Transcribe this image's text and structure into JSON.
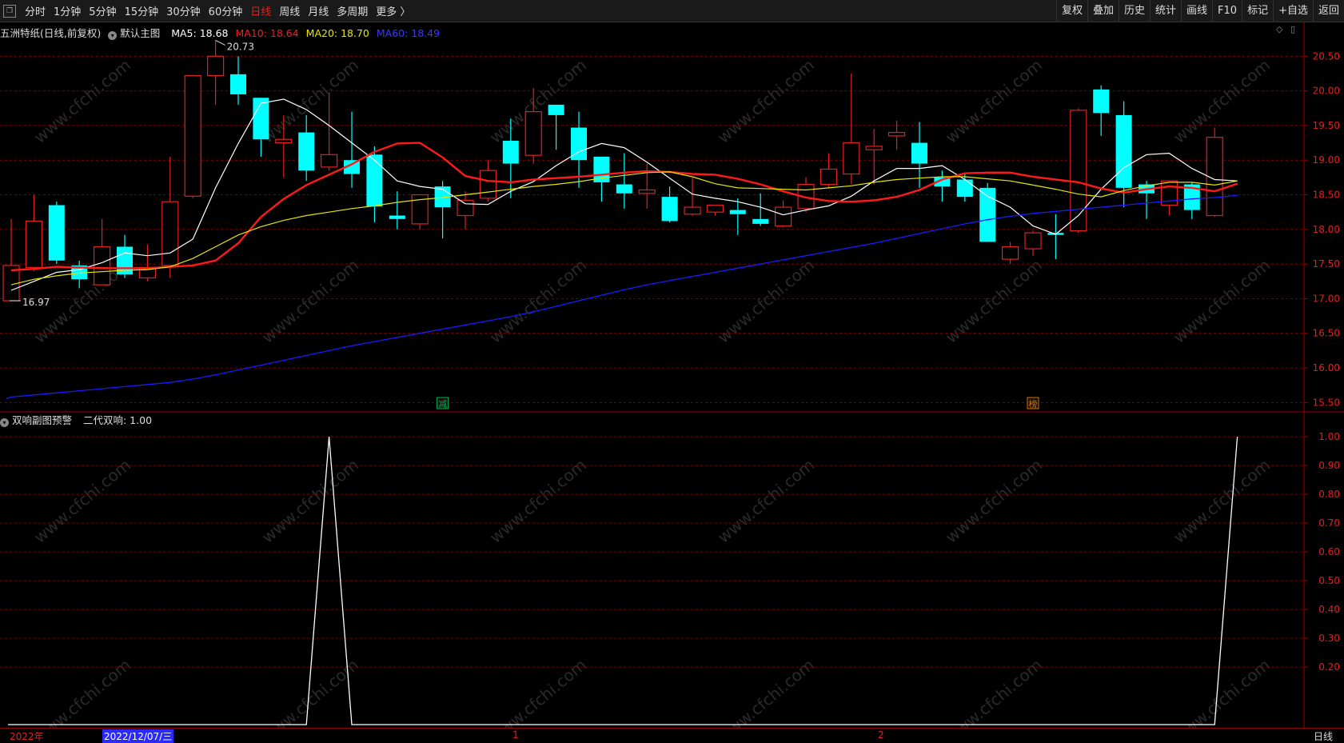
{
  "toolbar": {
    "window_icon": "window-restore-icon",
    "periods": [
      "分时",
      "1分钟",
      "5分钟",
      "15分钟",
      "30分钟",
      "60分钟",
      "日线",
      "周线",
      "月线",
      "多周期",
      "更多 〉"
    ],
    "active_period": "日线",
    "tools": [
      "复权",
      "叠加",
      "历史",
      "统计",
      "画线",
      "F10",
      "标记",
      "+自选",
      "返回"
    ]
  },
  "main_panel": {
    "title": "五洲特纸(日线,前复权)",
    "indicator_name": "默认主图",
    "ma5_label": "MA5: 18.68",
    "ma10_label": "MA10: 18.64",
    "ma20_label": "MA20: 18.70",
    "ma60_label": "MA60: 18.49",
    "high_marker": "20.73",
    "low_marker": "16.97",
    "event_tags": [
      "减",
      "榜"
    ]
  },
  "sub_panel": {
    "indicator_name": "双响副图预警",
    "value_label": "二代双响: 1.00"
  },
  "date_axis": {
    "year_label": "2022年",
    "cursor_date": "2022/12/07/三",
    "month_1": "1",
    "month_2": "2",
    "period_tag": "日线"
  },
  "watermark": "www.cfchi.com",
  "colors": {
    "up": "#e02020",
    "down": "#00ffff",
    "ma5": "#ffffff",
    "ma10": "#ff1a1a",
    "ma20": "#e6e600",
    "ma60": "#1a1aff",
    "grid": "#7a0000"
  },
  "chart_data": [
    {
      "type": "candlestick",
      "title": "五洲特纸(日线,前复权)",
      "ylim": [
        15.4,
        20.85
      ],
      "y_ticks": [
        15.5,
        16.0,
        16.5,
        17.0,
        17.5,
        18.0,
        18.5,
        19.0,
        19.5,
        20.0,
        20.5
      ],
      "candles": [
        {
          "o": 16.97,
          "h": 18.15,
          "l": 16.97,
          "c": 17.48
        },
        {
          "o": 17.45,
          "h": 18.5,
          "l": 17.4,
          "c": 18.12
        },
        {
          "o": 18.35,
          "h": 18.4,
          "l": 17.5,
          "c": 17.55
        },
        {
          "o": 17.48,
          "h": 17.55,
          "l": 17.15,
          "c": 17.28
        },
        {
          "o": 17.2,
          "h": 18.15,
          "l": 17.2,
          "c": 17.75
        },
        {
          "o": 17.75,
          "h": 17.92,
          "l": 17.3,
          "c": 17.35
        },
        {
          "o": 17.3,
          "h": 17.78,
          "l": 17.25,
          "c": 17.45
        },
        {
          "o": 17.48,
          "h": 19.05,
          "l": 17.3,
          "c": 18.4
        },
        {
          "o": 18.48,
          "h": 20.2,
          "l": 18.45,
          "c": 20.22
        },
        {
          "o": 20.22,
          "h": 20.73,
          "l": 19.8,
          "c": 20.5
        },
        {
          "o": 20.24,
          "h": 20.5,
          "l": 19.8,
          "c": 19.95
        },
        {
          "o": 19.9,
          "h": 19.9,
          "l": 19.05,
          "c": 19.3
        },
        {
          "o": 19.25,
          "h": 19.65,
          "l": 18.75,
          "c": 19.3
        },
        {
          "o": 19.4,
          "h": 19.65,
          "l": 18.7,
          "c": 18.85
        },
        {
          "o": 18.9,
          "h": 19.98,
          "l": 18.85,
          "c": 19.08
        },
        {
          "o": 19.0,
          "h": 19.7,
          "l": 18.6,
          "c": 18.8
        },
        {
          "o": 19.08,
          "h": 19.2,
          "l": 18.1,
          "c": 18.33
        },
        {
          "o": 18.2,
          "h": 18.55,
          "l": 18.0,
          "c": 18.15
        },
        {
          "o": 18.08,
          "h": 18.5,
          "l": 18.0,
          "c": 18.5
        },
        {
          "o": 18.62,
          "h": 18.7,
          "l": 17.87,
          "c": 18.32
        },
        {
          "o": 18.2,
          "h": 18.55,
          "l": 18.0,
          "c": 18.42
        },
        {
          "o": 18.45,
          "h": 19.0,
          "l": 18.4,
          "c": 18.85
        },
        {
          "o": 19.28,
          "h": 19.6,
          "l": 18.45,
          "c": 18.95
        },
        {
          "o": 19.07,
          "h": 20.04,
          "l": 18.95,
          "c": 19.7
        },
        {
          "o": 19.8,
          "h": 19.8,
          "l": 19.15,
          "c": 19.65
        },
        {
          "o": 19.47,
          "h": 19.7,
          "l": 18.6,
          "c": 19.0
        },
        {
          "o": 19.05,
          "h": 19.05,
          "l": 18.4,
          "c": 18.68
        },
        {
          "o": 18.65,
          "h": 19.1,
          "l": 18.3,
          "c": 18.52
        },
        {
          "o": 18.52,
          "h": 18.95,
          "l": 18.3,
          "c": 18.57
        },
        {
          "o": 18.47,
          "h": 18.62,
          "l": 18.1,
          "c": 18.12
        },
        {
          "o": 18.22,
          "h": 18.75,
          "l": 18.2,
          "c": 18.32
        },
        {
          "o": 18.25,
          "h": 18.35,
          "l": 18.2,
          "c": 18.35
        },
        {
          "o": 18.28,
          "h": 18.45,
          "l": 17.92,
          "c": 18.22
        },
        {
          "o": 18.15,
          "h": 18.52,
          "l": 18.05,
          "c": 18.08
        },
        {
          "o": 18.05,
          "h": 18.42,
          "l": 18.03,
          "c": 18.32
        },
        {
          "o": 18.3,
          "h": 18.75,
          "l": 18.25,
          "c": 18.65
        },
        {
          "o": 18.65,
          "h": 19.1,
          "l": 18.6,
          "c": 18.87
        },
        {
          "o": 18.8,
          "h": 20.25,
          "l": 18.65,
          "c": 19.25
        },
        {
          "o": 19.15,
          "h": 19.45,
          "l": 18.65,
          "c": 19.2
        },
        {
          "o": 19.35,
          "h": 19.57,
          "l": 19.15,
          "c": 19.4
        },
        {
          "o": 19.25,
          "h": 19.55,
          "l": 18.6,
          "c": 18.95
        },
        {
          "o": 18.75,
          "h": 18.85,
          "l": 18.4,
          "c": 18.62
        },
        {
          "o": 18.72,
          "h": 18.8,
          "l": 18.4,
          "c": 18.47
        },
        {
          "o": 18.6,
          "h": 18.67,
          "l": 17.82,
          "c": 17.82
        },
        {
          "o": 17.57,
          "h": 17.82,
          "l": 17.5,
          "c": 17.75
        },
        {
          "o": 17.72,
          "h": 17.98,
          "l": 17.62,
          "c": 17.95
        },
        {
          "o": 17.95,
          "h": 18.22,
          "l": 17.57,
          "c": 17.92
        },
        {
          "o": 17.98,
          "h": 19.75,
          "l": 17.95,
          "c": 19.72
        },
        {
          "o": 20.02,
          "h": 20.08,
          "l": 19.35,
          "c": 19.68
        },
        {
          "o": 19.65,
          "h": 19.85,
          "l": 18.32,
          "c": 18.6
        },
        {
          "o": 18.65,
          "h": 18.7,
          "l": 18.15,
          "c": 18.52
        },
        {
          "o": 18.35,
          "h": 18.7,
          "l": 18.2,
          "c": 18.7
        },
        {
          "o": 18.65,
          "h": 18.68,
          "l": 18.15,
          "c": 18.28
        },
        {
          "o": 18.2,
          "h": 19.47,
          "l": 18.18,
          "c": 19.33
        }
      ],
      "series": [
        {
          "name": "MA5",
          "values": [
            17.12,
            17.25,
            17.38,
            17.42,
            17.52,
            17.66,
            17.62,
            17.66,
            17.86,
            18.6,
            19.24,
            19.82,
            19.88,
            19.73,
            19.5,
            19.25,
            19.0,
            18.7,
            18.62,
            18.58,
            18.37,
            18.36,
            18.55,
            18.69,
            18.92,
            19.12,
            19.24,
            19.18,
            18.97,
            18.74,
            18.51,
            18.45,
            18.4,
            18.32,
            18.21,
            18.28,
            18.34,
            18.48,
            18.7,
            18.88,
            18.88,
            18.92,
            18.72,
            18.48,
            18.32,
            18.05,
            17.93,
            18.2,
            18.58,
            18.89,
            19.08,
            19.1,
            18.88,
            18.72,
            18.7
          ]
        },
        {
          "name": "MA10",
          "values": [
            17.41,
            17.43,
            17.46,
            17.45,
            17.44,
            17.44,
            17.44,
            17.46,
            17.48,
            17.55,
            17.8,
            18.18,
            18.44,
            18.64,
            18.79,
            18.94,
            19.12,
            19.24,
            19.25,
            19.04,
            18.77,
            18.7,
            18.68,
            18.72,
            18.74,
            18.76,
            18.79,
            18.82,
            18.84,
            18.83,
            18.8,
            18.79,
            18.73,
            18.65,
            18.55,
            18.46,
            18.41,
            18.4,
            18.42,
            18.47,
            18.57,
            18.72,
            18.81,
            18.82,
            18.82,
            18.76,
            18.72,
            18.68,
            18.59,
            18.53,
            18.58,
            18.62,
            18.6,
            18.55,
            18.66
          ]
        },
        {
          "name": "MA20",
          "values": [
            17.2,
            17.28,
            17.33,
            17.37,
            17.39,
            17.41,
            17.42,
            17.46,
            17.58,
            17.75,
            17.92,
            18.04,
            18.13,
            18.2,
            18.25,
            18.3,
            18.34,
            18.39,
            18.43,
            18.46,
            18.5,
            18.54,
            18.58,
            18.62,
            18.65,
            18.69,
            18.74,
            18.78,
            18.82,
            18.83,
            18.76,
            18.66,
            18.6,
            18.59,
            18.58,
            18.57,
            18.6,
            18.63,
            18.68,
            18.72,
            18.74,
            18.76,
            18.76,
            18.73,
            18.7,
            18.64,
            18.58,
            18.51,
            18.47,
            18.56,
            18.63,
            18.68,
            18.68,
            18.64,
            18.7
          ]
        },
        {
          "name": "MA60",
          "values": [
            15.58,
            15.61,
            15.64,
            15.67,
            15.7,
            15.73,
            15.76,
            15.79,
            15.84,
            15.9,
            15.97,
            16.04,
            16.11,
            16.18,
            16.25,
            16.32,
            16.38,
            16.44,
            16.5,
            16.56,
            16.62,
            16.68,
            16.74,
            16.81,
            16.89,
            16.97,
            17.05,
            17.13,
            17.2,
            17.26,
            17.32,
            17.38,
            17.44,
            17.5,
            17.56,
            17.62,
            17.68,
            17.74,
            17.8,
            17.87,
            17.94,
            18.01,
            18.08,
            18.14,
            18.19,
            18.23,
            18.26,
            18.29,
            18.32,
            18.35,
            18.38,
            18.41,
            18.44,
            18.46,
            18.49
          ]
        }
      ]
    },
    {
      "type": "line",
      "title": "双响副图预警",
      "ylim": [
        0,
        1.05
      ],
      "y_ticks": [
        0.2,
        0.3,
        0.4,
        0.5,
        0.6,
        0.7,
        0.8,
        0.9,
        1.0
      ],
      "series": [
        {
          "name": "二代双响",
          "values": [
            0,
            0,
            0,
            0,
            0,
            0,
            0,
            0,
            0,
            0,
            0,
            0,
            0,
            0,
            1,
            0,
            0,
            0,
            0,
            0,
            0,
            0,
            0,
            0,
            0,
            0,
            0,
            0,
            0,
            0,
            0,
            0,
            0,
            0,
            0,
            0,
            0,
            0,
            0,
            0,
            0,
            0,
            0,
            0,
            0,
            0,
            0,
            0,
            0,
            0,
            0,
            0,
            0,
            0,
            1
          ]
        }
      ]
    }
  ]
}
